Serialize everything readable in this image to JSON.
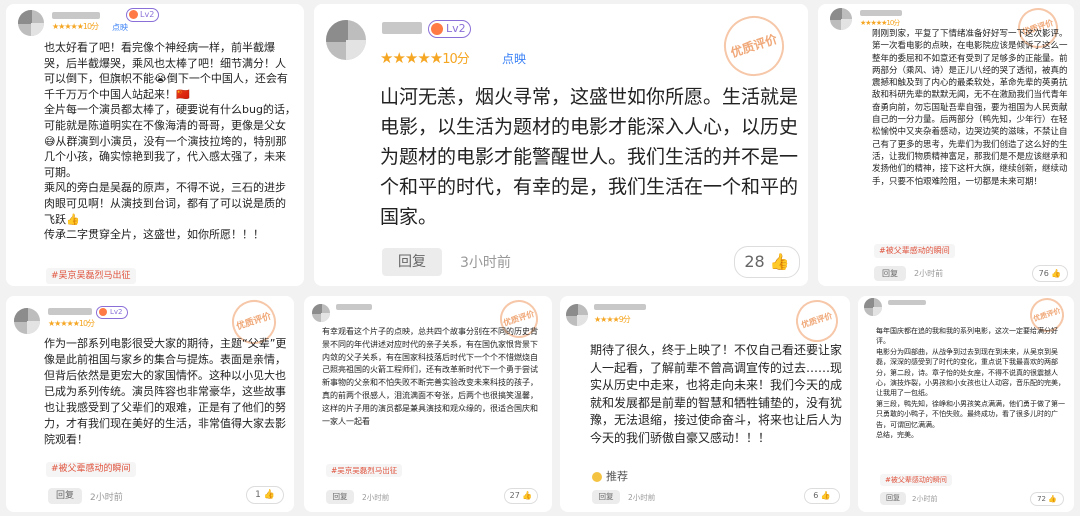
{
  "cards": [
    {
      "id": "c1",
      "level": "Lv2",
      "stars": "★★★★★",
      "score": "10分",
      "tag": "点映",
      "text": "也太好看了吧！看完像个神经病一样，前半截爆哭，后半截爆哭，乘风也太棒了吧！细节满分！人可以倒下，但旗帜不能😭倒下一个中国人，还会有千千万万个中国人站起来！🇨🇳\n全片每一个演员都太棒了，硬要说有什么bug的话，可能就是陈道明实在不像海清的哥哥，更像是父女😅从群演到小演员，没有一个演技拉垮的，特别那几个小孩，确实惊艳到我了，代入感太强了，未来可期。\n乘风的旁白是吴磊的原声，不得不说，三石的进步肉眼可见啊！从演技到台词，都有了可以说是质的飞跃👍\n传承二字贯穿全片，这盛世，如你所愿！！！",
      "hashtag": "#吴京吴磊烈马出征"
    },
    {
      "id": "c2",
      "level": "Lv2",
      "stars": "★★★★★",
      "score": "10分",
      "tag": "点映",
      "seal": "优质评价",
      "text": "山河无恙，烟火寻常，这盛世如你所愿。生活就是电影，以生活为题材的电影才能深入人心，以历史为题材的电影才能警醒世人。我们生活的并不是一个和平的时代，有幸的是，我们生活在一个和平的国家。",
      "reply": "回复",
      "time": "3小时前",
      "likes": "28"
    },
    {
      "id": "c3",
      "stars": "★★★★★",
      "score": "10分",
      "seal": "优质评价",
      "text": "刚刚到家，平复了下情绪准备好好写一下这次影评。第一次看电影的点映，在电影院应该是倾诉了这么一整年的委屈和不如意还有受到了足够多的正能量。前两部分（乘风、诗）是正儿八经的哭了透彻，被真的震撼和触及到了内心的最柔软处，革命先辈的英勇抗敌和科研先辈的默默无闻，无不在激励我们当代青年奋勇向前，勿忘国耻吾辈自强，要为祖国为人民贡献自己的一分力量。后两部分（鸭先知，少年行）在轻松愉悦中又夹杂着感动，边哭边笑的滋味，不禁让自己有了更多的思考，先辈们为我们创造了这么好的生活，让我们物质精神富足，那我们是不是应该继承和发扬他们的精神，接下这杆大旗，继续创新，继续动手，只要不怕艰难险阻，一切都是未来可期！",
      "hashtag": "#被父辈感动的瞬间",
      "reply": "回复",
      "time": "2小时前",
      "likes": "76"
    },
    {
      "id": "c4",
      "level": "Lv2",
      "stars": "★★★★★",
      "score": "10分",
      "seal": "优质评价",
      "text": "作为一部系列电影很受大家的期待，主题“父辈”更像是此前祖国与家乡的集合与提炼。表面是亲情，但背后依然是更宏大的家国情怀。这种以小见大也已成为系列传统。演员阵容也非常豪华，这些故事也让我感受到了父辈们的艰难，正是有了他们的努力，才有我们现在美好的生活，非常值得大家去影院观看！",
      "hashtag": "#被父辈感动的瞬间",
      "reply": "回复",
      "time": "2小时前",
      "likes": "1"
    },
    {
      "id": "c5",
      "seal": "优质评价",
      "text": "有幸观看这个片子的点映，总共四个故事分别在不同的历史背景不同的年代讲述对应时代的亲子关系，有在国仇家恨背景下内敛的父子关系，有在国家科技落后时代下一个个不惜燃烧自己照亮祖国的火箭工程师们，还有改革新时代下一个勇于尝试新事物的父亲和不怕失败不断完善实验改变未来科技的孩子，真的前两个很感人，泪流满面不夸张，后两个也很搞笑温馨，这样的片子用的演员都是兼具演技和观众缘的，很适合国庆和一家人一起看",
      "hashtag": "#吴京吴磊烈马出征",
      "reply": "回复",
      "time": "2小时前",
      "likes": "27"
    },
    {
      "id": "c6",
      "stars": "★★★★",
      "score": "9分",
      "seal": "优质评价",
      "text": "期待了很久，终于上映了！不仅自己看还要让家人一起看，了解前辈不曾高调宣传的过去……现实从历史中走来，也将走向未来！我们今天的成就和发展都是前辈的智慧和牺牲铺垫的，没有犹豫，无法退缩，接过使命奋斗，将来也让后人为今天的我们骄傲自豪又感动！！！",
      "recommend": "推荐",
      "reply": "回复",
      "time": "2小时前",
      "likes": "6"
    },
    {
      "id": "c7",
      "seal": "优质评价",
      "text": "每年国庆都在追的我和我的系列电影，这次一定要给满分好评。\n电影分为四部曲，从战争到过去到现在到未来，从吴京到吴磊，深深的感受到了时代的变化，重点说下我最喜欢的两部分，第二段，诗。章子怡的处女座，不得不说真的很震撼人心，演技炸裂，小男孩和小女孩也让人动容，音乐配的完美，让我用了一包纸。\n第三段，鸭先知，徐峥和小男孩笑点满满，他们勇于做了第一只勇敢的小鸭子，不怕失败。最终成功，看了很多儿时的广告，可谓回忆满满。\n总结，完美。",
      "hashtag": "#被父辈感动的瞬间",
      "reply": "回复",
      "time": "2小时前",
      "likes": "72"
    }
  ]
}
